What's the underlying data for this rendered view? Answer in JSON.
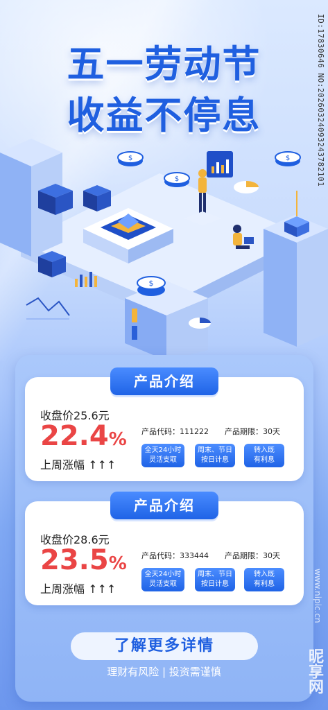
{
  "header": {
    "title_line1": "五一劳动节",
    "title_line2": "收益不停息"
  },
  "watermark": {
    "id_text": "ID:17830646 NO:20260324093243782101",
    "site": "www.nipic.cn",
    "brand": "昵享网"
  },
  "products": [
    {
      "heading": "产品介绍",
      "price": "收盘价25.6元",
      "percent": "22.4",
      "percent_symbol": "%",
      "week_label": "上周涨幅 ↑↑↑",
      "code": "产品代码：111222",
      "term": "产品期限：30天",
      "tags": [
        "全天24小时\n灵活支取",
        "周末、节日\n按日计息",
        "转入既\n有利息"
      ]
    },
    {
      "heading": "产品介绍",
      "price": "收盘价28.6元",
      "percent": "23.5",
      "percent_symbol": "%",
      "week_label": "上周涨幅 ↑↑↑",
      "code": "产品代码：333444",
      "term": "产品期限：30天",
      "tags": [
        "全天24小时\n灵活支取",
        "周末、节日\n按日计息",
        "转入既\n有利息"
      ]
    }
  ],
  "cta": {
    "more_label": "了解更多详情",
    "risk_text": "理财有风险 | 投资需谨慎"
  },
  "colors": {
    "brand_blue": "#1f5fe0",
    "accent_red": "#ea4545"
  }
}
